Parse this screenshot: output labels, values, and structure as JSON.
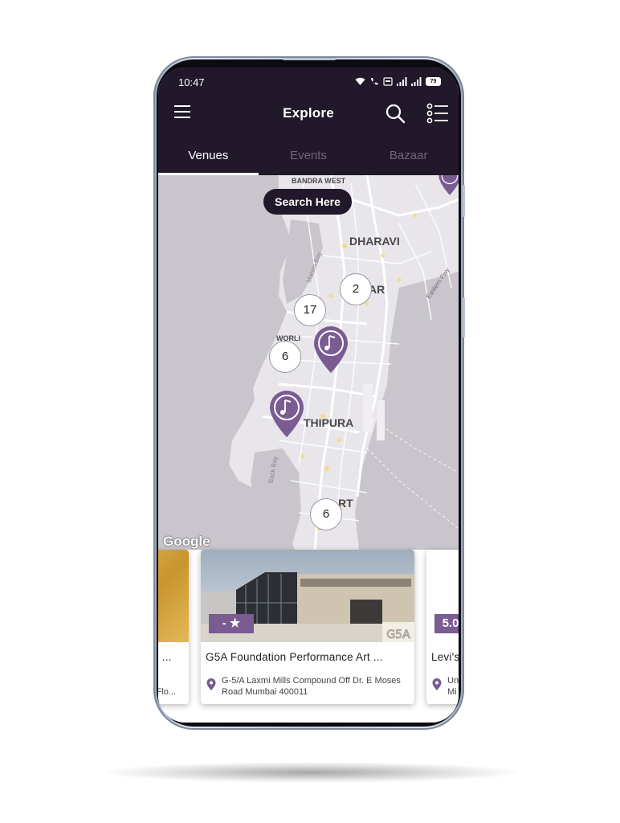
{
  "status_bar": {
    "time": "10:47",
    "battery": "79"
  },
  "header": {
    "title": "Explore"
  },
  "tabs": [
    {
      "label": "Venues",
      "active": true
    },
    {
      "label": "Events",
      "active": false
    },
    {
      "label": "Bazaar",
      "active": false
    }
  ],
  "map": {
    "search_here_label": "Search Here",
    "labels": {
      "bandra_west": "BANDRA WEST",
      "dharavi": "DHARAVI",
      "dadar_partial": "AR",
      "worli": "WORLI",
      "girgaon_partial": "THIPURA",
      "fort_partial": "RT",
      "mahim_bay": "Mahim Bay",
      "back_bay": "Back Bay",
      "eastern_fwy": "Eastern Fwy"
    },
    "clusters": [
      "2",
      "17",
      "6",
      "6"
    ],
    "attribution": "Google",
    "accent_color": "#7a5b92"
  },
  "cards": {
    "left_partial": {
      "name": "raji ...",
      "address": "st Flo..."
    },
    "main": {
      "rating": "- ★",
      "name": "G5A Foundation Performance Art ...",
      "address_line1": "G-5/A Laxmi Mills Compound Off Dr. E Moses",
      "address_line2": "Road Mumbai 400011",
      "signage": "G5A"
    },
    "right_partial": {
      "rating": "5.0",
      "name": "Levi's",
      "address_line1": "Un",
      "address_line2": "Mi"
    }
  }
}
